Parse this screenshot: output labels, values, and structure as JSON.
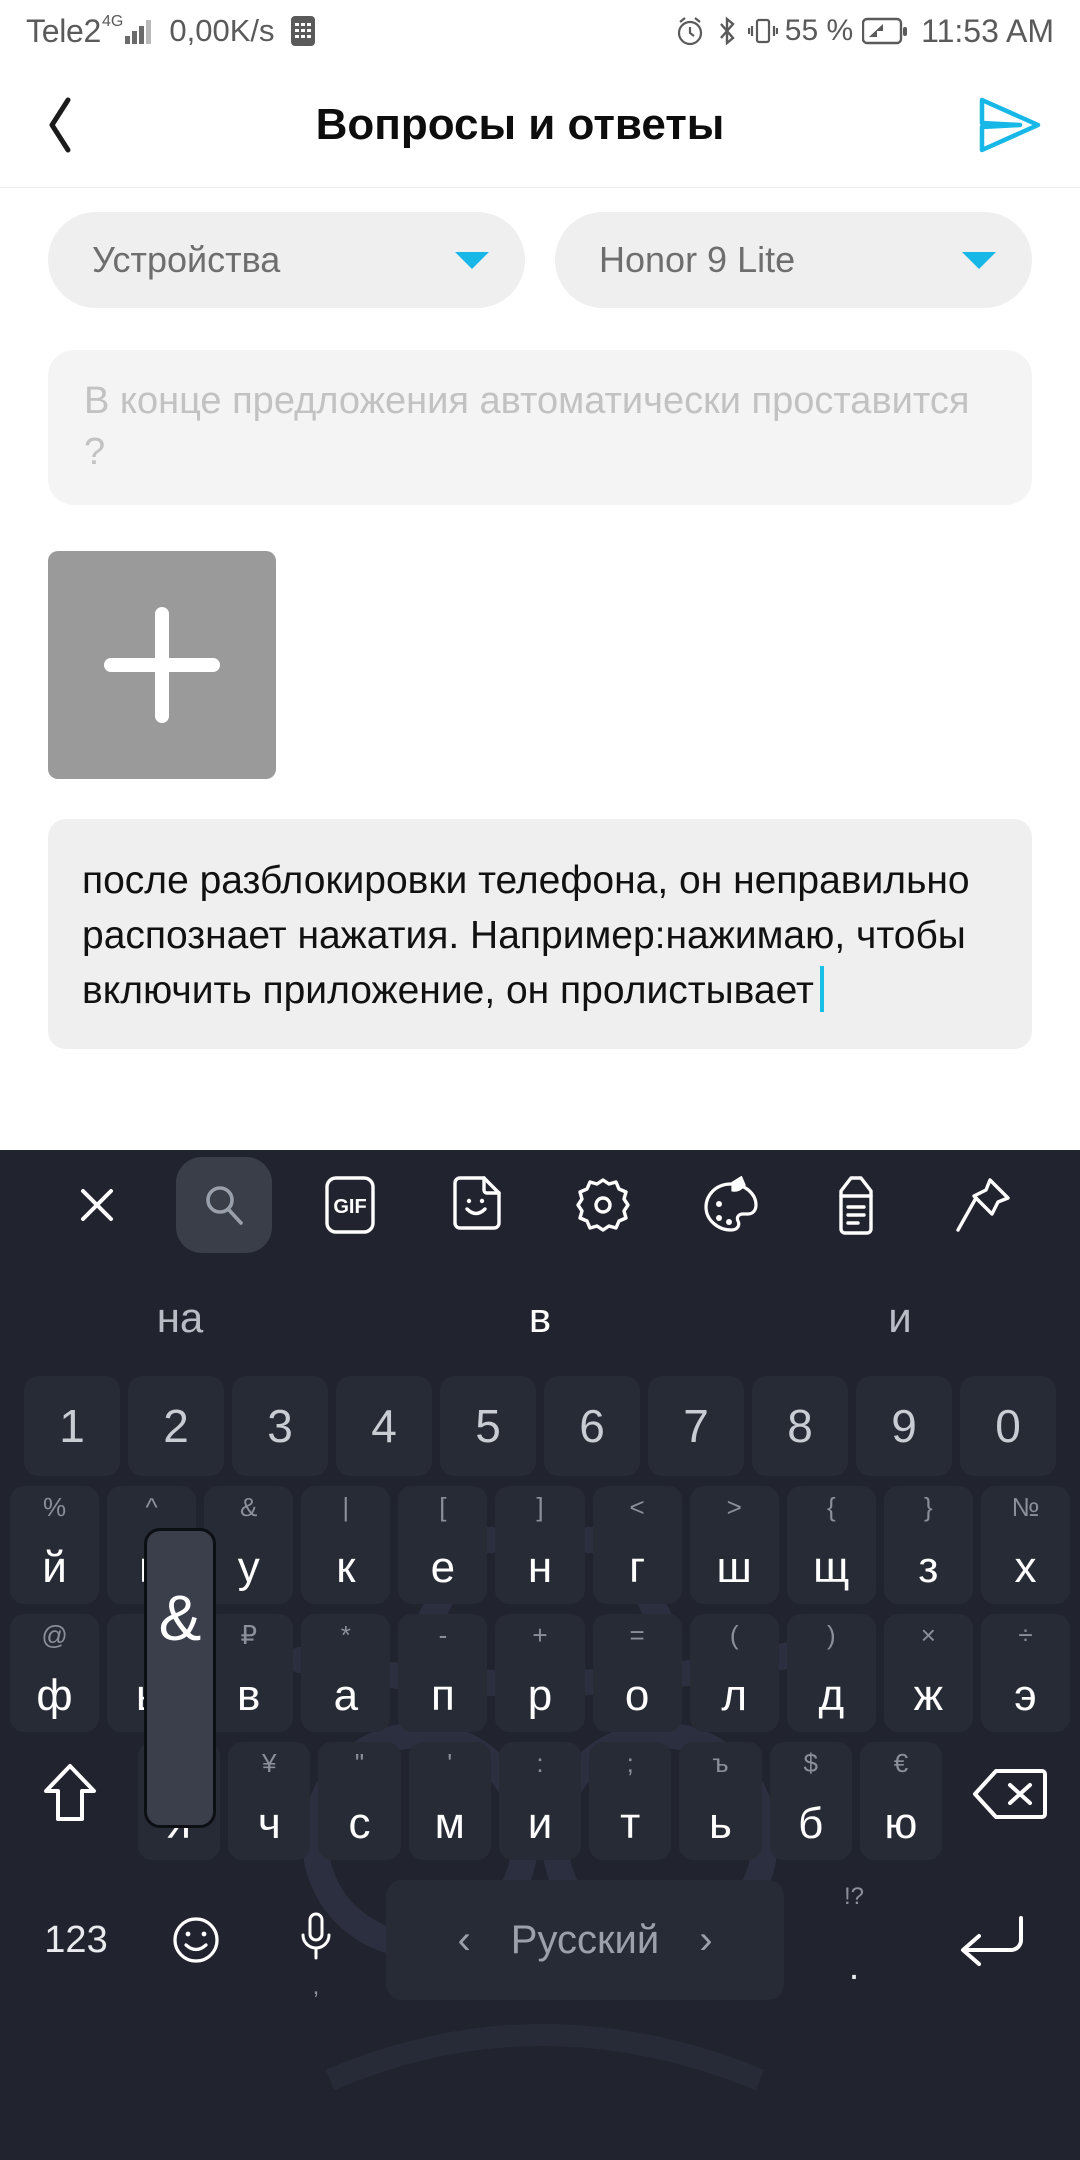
{
  "status_bar": {
    "carrier": "Tele2",
    "network": "4G",
    "data_speed": "0,00K/s",
    "battery_percent": "55 %",
    "clock": "11:53 AM",
    "icons": [
      "sim-card-icon",
      "alarm-clock-icon",
      "bluetooth-icon",
      "vibrate-icon",
      "battery-icon"
    ]
  },
  "app_bar": {
    "back_label": "‹",
    "title": "Вопросы и ответы",
    "send_label": "send-icon",
    "accent_color": "#17b8e8"
  },
  "form": {
    "device_selector": {
      "label": "Устройства"
    },
    "model_selector": {
      "label": "Honor 9 Lite"
    },
    "title_input": {
      "placeholder": "В конце предложения автоматически проставится ?",
      "value": ""
    },
    "attach_button": {
      "label": "+"
    },
    "body_input": {
      "value": "после разблокировки телефона, он неправильно распознает нажатия. Например:нажимаю, чтобы включить приложение, он пролистывает",
      "caret_color": "#18c0e8"
    }
  },
  "keyboard": {
    "toolbar": [
      {
        "name": "close-icon",
        "label": "✕",
        "selected": false
      },
      {
        "name": "search-icon",
        "label": "search",
        "selected": true
      },
      {
        "name": "gif-icon",
        "label": "GIF",
        "selected": false
      },
      {
        "name": "sticker-icon",
        "label": "sticker",
        "selected": false
      },
      {
        "name": "gear-icon",
        "label": "settings",
        "selected": false
      },
      {
        "name": "palette-icon",
        "label": "theme",
        "selected": false
      },
      {
        "name": "clipboard-icon",
        "label": "clipboard",
        "selected": false
      },
      {
        "name": "pin-icon",
        "label": "pin",
        "selected": false
      }
    ],
    "suggestions": [
      "на",
      "в",
      "и"
    ],
    "number_row": [
      "1",
      "2",
      "3",
      "4",
      "5",
      "6",
      "7",
      "8",
      "9",
      "0"
    ],
    "row1": [
      {
        "main": "й",
        "sub": "%"
      },
      {
        "main": "ц",
        "sub": "^"
      },
      {
        "main": "у",
        "sub": "&"
      },
      {
        "main": "к",
        "sub": "|"
      },
      {
        "main": "е",
        "sub": "["
      },
      {
        "main": "н",
        "sub": "]"
      },
      {
        "main": "г",
        "sub": "<"
      },
      {
        "main": "ш",
        "sub": ">"
      },
      {
        "main": "щ",
        "sub": "{"
      },
      {
        "main": "з",
        "sub": "}"
      },
      {
        "main": "х",
        "sub": "№"
      }
    ],
    "row2": [
      {
        "main": "ф",
        "sub": "@"
      },
      {
        "main": "ы",
        "sub": "#"
      },
      {
        "main": "в",
        "sub": "₽"
      },
      {
        "main": "а",
        "sub": "*"
      },
      {
        "main": "п",
        "sub": "-"
      },
      {
        "main": "р",
        "sub": "+"
      },
      {
        "main": "о",
        "sub": "="
      },
      {
        "main": "л",
        "sub": "("
      },
      {
        "main": "д",
        "sub": ")"
      },
      {
        "main": "ж",
        "sub": "×"
      },
      {
        "main": "э",
        "sub": "÷"
      }
    ],
    "row3": [
      {
        "main": "я",
        "sub": "_"
      },
      {
        "main": "ч",
        "sub": "¥"
      },
      {
        "main": "с",
        "sub": "\""
      },
      {
        "main": "м",
        "sub": "'"
      },
      {
        "main": "и",
        "sub": ":"
      },
      {
        "main": "т",
        "sub": ";"
      },
      {
        "main": "ь",
        "sub": "ъ"
      },
      {
        "main": "б",
        "sub": "$"
      },
      {
        "main": "ю",
        "sub": "€"
      }
    ],
    "shift_key": "shift-icon",
    "backspace_key": "backspace-icon",
    "bottom_row": {
      "numbers_key": "123",
      "emoji_key": "emoji-icon",
      "mic_key": "microphone-icon",
      "comma_key": ",",
      "space_language": "Русский",
      "prev_lang": "‹",
      "next_lang": "›",
      "period_key": ".",
      "period_sub": "!?",
      "enter_key": "enter-icon"
    },
    "popup": {
      "glyph": "&",
      "from_key": "у"
    },
    "background_color": "#21242e",
    "key_color": "#272b36"
  }
}
